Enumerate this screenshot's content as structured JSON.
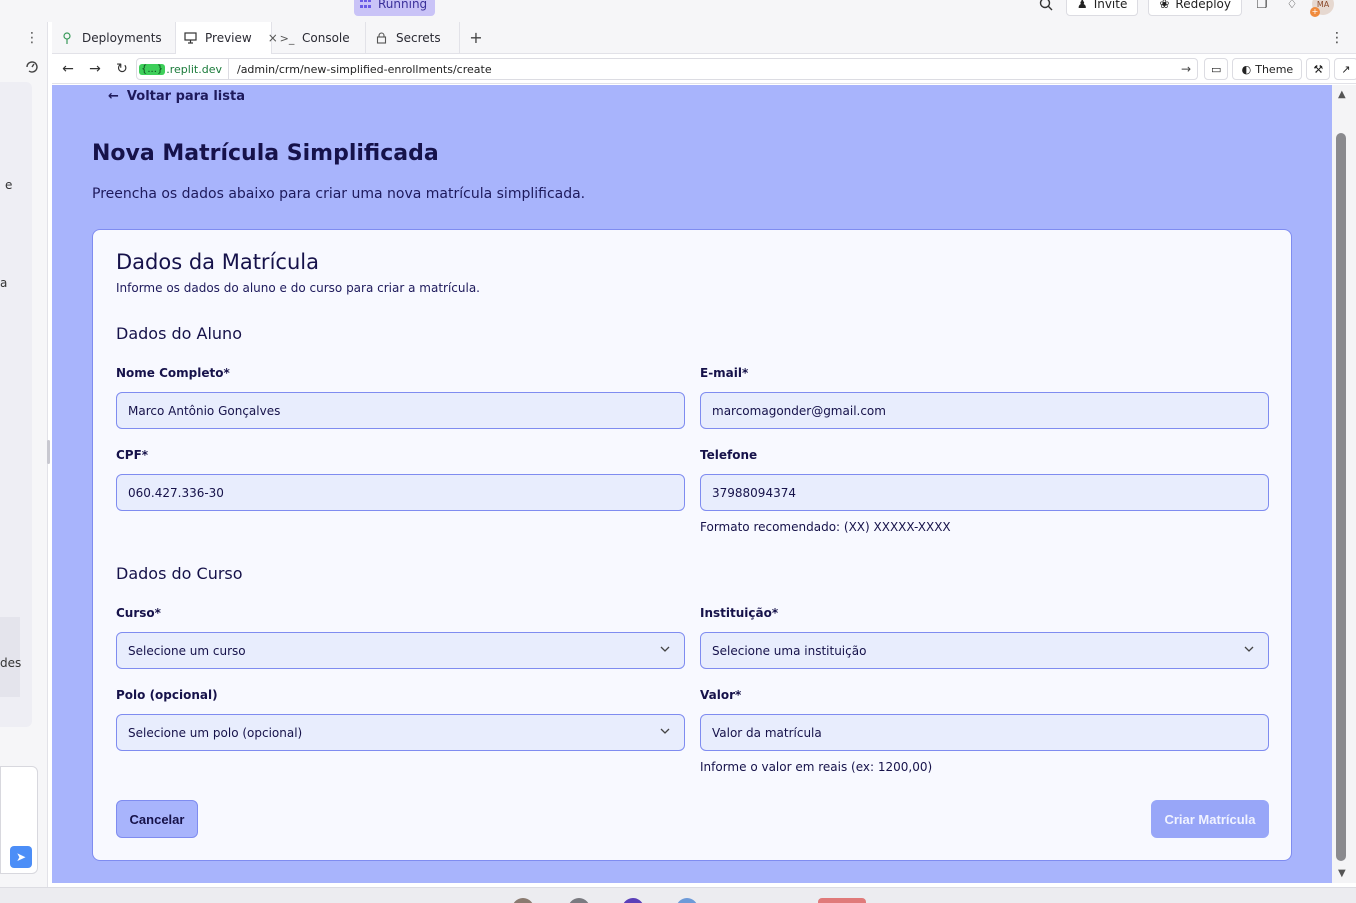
{
  "topbar": {
    "running_label": "Running",
    "invite_label": "Invite",
    "redeploy_label": "Redeploy",
    "avatar_initials": "MA"
  },
  "left_pane": {
    "fragments": [
      "e",
      "a",
      "des"
    ]
  },
  "tabs": [
    {
      "label": "Deployments",
      "icon": "deployments-icon",
      "active": false
    },
    {
      "label": "Preview",
      "icon": "monitor-icon",
      "active": true
    },
    {
      "label": "Console",
      "icon": "terminal-icon",
      "active": false
    },
    {
      "label": "Secrets",
      "icon": "lock-icon",
      "active": false
    }
  ],
  "browser": {
    "domain_badge": "{...}",
    "domain": ".replit.dev",
    "path": "/admin/crm/new-simplified-enrollments/create",
    "theme_label": "Theme"
  },
  "page": {
    "back_label": "Voltar para lista",
    "title": "Nova Matrícula Simplificada",
    "subtitle": "Preencha os dados abaixo para criar uma nova matrícula simplificada."
  },
  "card": {
    "title": "Dados da Matrícula",
    "subtitle": "Informe os dados do aluno e do curso para criar a matrícula.",
    "student_section": "Dados do Aluno",
    "course_section": "Dados do Curso"
  },
  "fields": {
    "name": {
      "label": "Nome Completo*",
      "value": "Marco Antônio Gonçalves"
    },
    "email": {
      "label": "E-mail*",
      "value": "marcomagonder@gmail.com"
    },
    "cpf": {
      "label": "CPF*",
      "value": "060.427.336-30"
    },
    "phone": {
      "label": "Telefone",
      "value": "37988094374",
      "hint": "Formato recomendado: (XX) XXXXX-XXXX"
    },
    "course": {
      "label": "Curso*",
      "value": "Selecione um curso"
    },
    "institution": {
      "label": "Instituição*",
      "value": "Selecione uma instituição"
    },
    "polo": {
      "label": "Polo (opcional)",
      "value": "Selecione um polo (opcional)"
    },
    "amount": {
      "label": "Valor*",
      "placeholder": "Valor da matrícula",
      "hint": "Informe o valor em reais (ex: 1200,00)"
    }
  },
  "buttons": {
    "cancel": "Cancelar",
    "create": "Criar Matrícula"
  },
  "colors": {
    "page_bg": "#a8b4fc",
    "card_bg": "#f8f9ff",
    "input_bg": "#e8edfd",
    "border": "#7f8cf0",
    "text": "#16124a"
  }
}
